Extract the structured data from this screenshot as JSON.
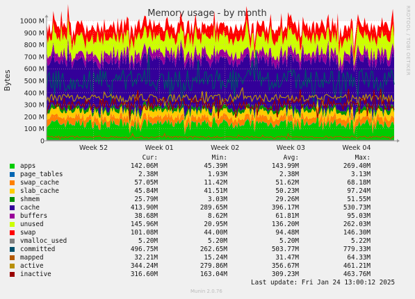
{
  "chart_data": {
    "type": "area",
    "title": "Memory usage - by month",
    "ylabel": "Bytes",
    "ylim": [
      0,
      1000000000
    ],
    "y_ticks": [
      {
        "value": 0,
        "label": "0"
      },
      {
        "value": 100000000,
        "label": "100 M"
      },
      {
        "value": 200000000,
        "label": "200 M"
      },
      {
        "value": 300000000,
        "label": "300 M"
      },
      {
        "value": 400000000,
        "label": "400 M"
      },
      {
        "value": 500000000,
        "label": "500 M"
      },
      {
        "value": 600000000,
        "label": "600 M"
      },
      {
        "value": 700000000,
        "label": "700 M"
      },
      {
        "value": 800000000,
        "label": "800 M"
      },
      {
        "value": 900000000,
        "label": "900 M"
      },
      {
        "value": 1000000000,
        "label": "1000 M"
      }
    ],
    "x_range": [
      "2024-12-18",
      "2025-01-24"
    ],
    "x_ticks": [
      {
        "x": "2024-12-23",
        "label": "Week 52"
      },
      {
        "x": "2024-12-30",
        "label": "Week 01"
      },
      {
        "x": "2025-01-06",
        "label": "Week 02"
      },
      {
        "x": "2025-01-13",
        "label": "Week 03"
      },
      {
        "x": "2025-01-20",
        "label": "Week 04"
      }
    ],
    "grid": true,
    "side_label": "RRDTOOL / TOBI OETIKER",
    "stack_order": [
      "apps",
      "page_tables",
      "swap_cache",
      "slab_cache",
      "shmem",
      "cache",
      "buffers",
      "unused",
      "swap"
    ],
    "line_series": [
      "vmalloc_used",
      "committed",
      "mapped",
      "active",
      "inactive"
    ],
    "series": [
      {
        "name": "apps",
        "color": "#00CC00",
        "cur": "142.06M",
        "min": "45.39M",
        "avg": "143.99M",
        "max": "269.40M"
      },
      {
        "name": "page_tables",
        "color": "#0066B3",
        "cur": "2.38M",
        "min": "1.93M",
        "avg": "2.38M",
        "max": "3.13M"
      },
      {
        "name": "swap_cache",
        "color": "#FF8000",
        "cur": "57.05M",
        "min": "11.42M",
        "avg": "51.62M",
        "max": "68.18M"
      },
      {
        "name": "slab_cache",
        "color": "#FFCC00",
        "cur": "45.84M",
        "min": "41.51M",
        "avg": "50.23M",
        "max": "97.24M"
      },
      {
        "name": "shmem",
        "color": "#008F00",
        "cur": "25.79M",
        "min": "3.03M",
        "avg": "29.26M",
        "max": "51.55M"
      },
      {
        "name": "cache",
        "color": "#330099",
        "cur": "413.90M",
        "min": "289.65M",
        "avg": "396.17M",
        "max": "530.73M"
      },
      {
        "name": "buffers",
        "color": "#990099",
        "cur": "38.68M",
        "min": "8.62M",
        "avg": "61.81M",
        "max": "95.03M"
      },
      {
        "name": "unused",
        "color": "#CCFF00",
        "cur": "145.96M",
        "min": "20.95M",
        "avg": "136.20M",
        "max": "262.03M"
      },
      {
        "name": "swap",
        "color": "#FF0000",
        "cur": "101.08M",
        "min": "44.00M",
        "avg": "94.48M",
        "max": "146.30M"
      },
      {
        "name": "vmalloc_used",
        "color": "#808080",
        "cur": "5.20M",
        "min": "5.20M",
        "avg": "5.20M",
        "max": "5.22M"
      },
      {
        "name": "committed",
        "color": "#004F6B",
        "cur": "496.75M",
        "min": "262.65M",
        "avg": "503.77M",
        "max": "779.33M"
      },
      {
        "name": "mapped",
        "color": "#B35900",
        "cur": "32.21M",
        "min": "15.24M",
        "avg": "31.47M",
        "max": "64.33M"
      },
      {
        "name": "active",
        "color": "#B8900A",
        "cur": "344.24M",
        "min": "279.86M",
        "avg": "356.67M",
        "max": "461.21M"
      },
      {
        "name": "inactive",
        "color": "#990000",
        "cur": "316.60M",
        "min": "163.04M",
        "avg": "309.23M",
        "max": "463.76M"
      }
    ]
  },
  "legend": {
    "headers": {
      "cur": "Cur:",
      "min": "Min:",
      "avg": "Avg:",
      "max": "Max:"
    }
  },
  "footer": {
    "last_update": "Last update: Fri Jan 24 13:00:12 2025",
    "generator": "Munin 2.0.76"
  }
}
